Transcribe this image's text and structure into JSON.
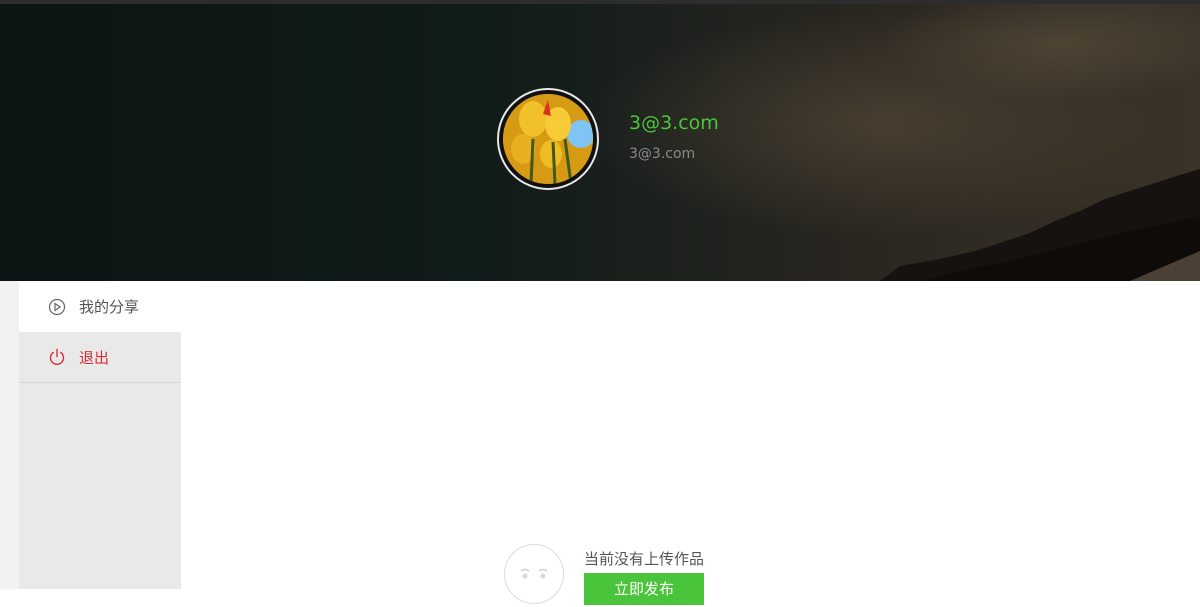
{
  "profile": {
    "name": "3@3.com",
    "email": "3@3.com"
  },
  "sidebar": {
    "items": [
      {
        "label": "我的分享",
        "icon": "play-circle-icon"
      },
      {
        "label": "退出",
        "icon": "power-icon"
      }
    ]
  },
  "empty_state": {
    "message": "当前没有上传作品",
    "button_label": "立即发布",
    "icon": "sad-face-icon"
  },
  "colors": {
    "accent": "#4ac43a",
    "logout": "#d9303a"
  }
}
